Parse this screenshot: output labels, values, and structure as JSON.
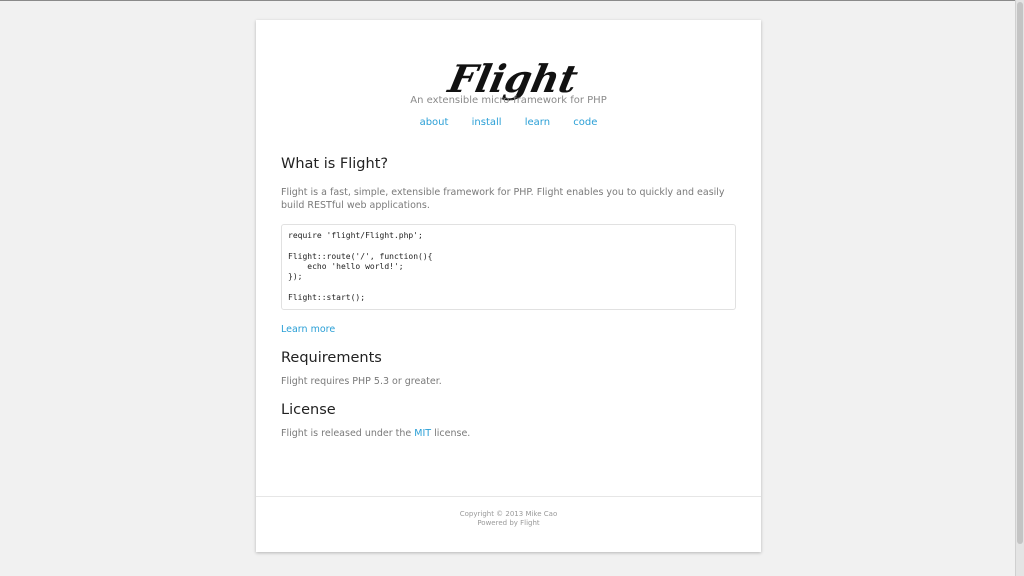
{
  "header": {
    "logo_text": "Flight",
    "tagline": "An extensible micro-framework for PHP",
    "nav": [
      {
        "label": "about"
      },
      {
        "label": "install"
      },
      {
        "label": "learn"
      },
      {
        "label": "code"
      }
    ]
  },
  "sections": {
    "what": {
      "title": "What is Flight?",
      "text": "Flight is a fast, simple, extensible framework for PHP. Flight enables you to quickly and easily build RESTful web applications.",
      "code": [
        "require 'flight/Flight.php';",
        "",
        "Flight::route('/', function(){",
        "    echo 'hello world!';",
        "});",
        "",
        "Flight::start();"
      ],
      "learn_more": "Learn more"
    },
    "requirements": {
      "title": "Requirements",
      "text": "Flight requires PHP 5.3 or greater."
    },
    "license": {
      "title": "License",
      "text_before": "Flight is released under the ",
      "link": "MIT",
      "text_after": " license."
    }
  },
  "footer": {
    "copyright": "Copyright © 2013 Mike Cao",
    "powered_prefix": "Powered by ",
    "powered_link": "Flight"
  },
  "colors": {
    "background": "#f1f1f1",
    "link": "#2a9fd6",
    "text": "#7a7a7a",
    "heading": "#222222"
  }
}
